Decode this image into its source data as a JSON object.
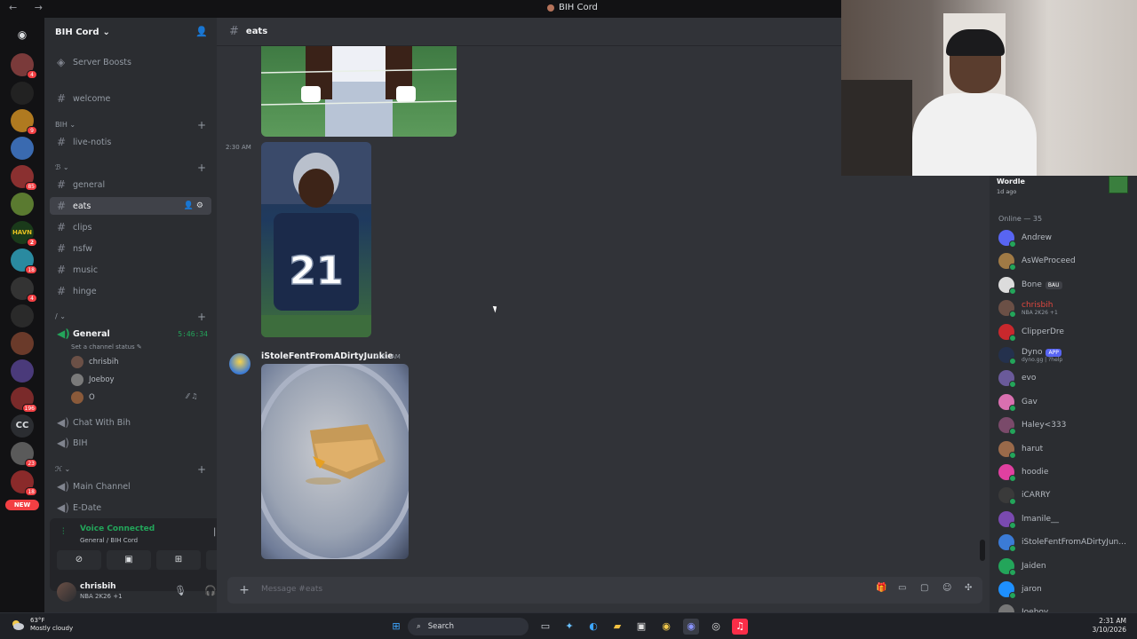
{
  "window": {
    "title": "BIH Cord"
  },
  "server": {
    "name": "BIH Cord",
    "boosts_label": "Server Boosts",
    "channels": {
      "welcome": "welcome",
      "cat_bih": "BIH",
      "live_notis": "live-notis",
      "cat_2": "ℬ",
      "general": "general",
      "eats": "eats",
      "clips": "clips",
      "nsfw": "nsfw",
      "music": "music",
      "hinge": "hinge",
      "cat_3": "/",
      "voice_general": "General",
      "voice_timer": "5:46:34",
      "voice_status": "Set a channel status",
      "voice_users": [
        "chrisbih",
        "Joeboy",
        "O"
      ],
      "chat_with_bih": "Chat With Bih",
      "bih": "BIH",
      "cat_4": "ℋ",
      "main_channel": "Main Channel",
      "e_date": "E-Date"
    },
    "rail_badges": [
      "4",
      "9",
      "85",
      "2",
      "18",
      "4",
      "196",
      "23",
      "18",
      "26"
    ],
    "rail_cc": "CC",
    "rail_new": "NEW"
  },
  "voice_panel": {
    "title": "Voice Connected",
    "subtitle": "General / BIH Cord"
  },
  "user_panel": {
    "name": "chrisbih",
    "status": "NBA 2K26 +1"
  },
  "channel": {
    "name": "eats",
    "timestamp_left": "2:30 AM",
    "message": {
      "author": "iStoleFentFromADirtyJunkie",
      "time": "2:31 AM"
    },
    "jersey_number": "21",
    "composer_placeholder": "Message #eats"
  },
  "members": {
    "activity_title": "Wordle",
    "activity_sub": "1d ago",
    "online_header": "Online — 35",
    "list": [
      {
        "name": "Andrew",
        "color": "#5865f2"
      },
      {
        "name": "AsWeProceed",
        "color": "#a07a45"
      },
      {
        "name": "Bone",
        "color": "#dcdcdc",
        "tag": "BAU"
      },
      {
        "name": "chrisbih",
        "color": "#6b5046",
        "sub": "NBA 2K26 +1",
        "red": true
      },
      {
        "name": "ClipperDre",
        "color": "#c8282d"
      },
      {
        "name": "Dyno",
        "color": "#24314d",
        "tag": "APP",
        "sub": "dyno.gg | ?help"
      },
      {
        "name": "evo",
        "color": "#6a5a9a"
      },
      {
        "name": "Gav",
        "color": "#d970b0"
      },
      {
        "name": "Haley<333",
        "color": "#7a4a6a"
      },
      {
        "name": "harut",
        "color": "#9a6a4a"
      },
      {
        "name": "hoodie",
        "color": "#e040a0"
      },
      {
        "name": "iCARRY",
        "color": "#3a3a3a"
      },
      {
        "name": "lmanile__",
        "color": "#7a4ab0"
      },
      {
        "name": "iStoleFentFromADirtyJun...",
        "color": "#3b7bd6"
      },
      {
        "name": "Jaiden",
        "color": "#23a55a"
      },
      {
        "name": "jaron",
        "color": "#1e90ff"
      },
      {
        "name": "Joeboy",
        "color": "#777"
      }
    ]
  },
  "taskbar": {
    "temp": "63°F",
    "weather": "Mostly cloudy",
    "search": "Search",
    "time": "2:31 AM",
    "date": "3/10/2026"
  }
}
